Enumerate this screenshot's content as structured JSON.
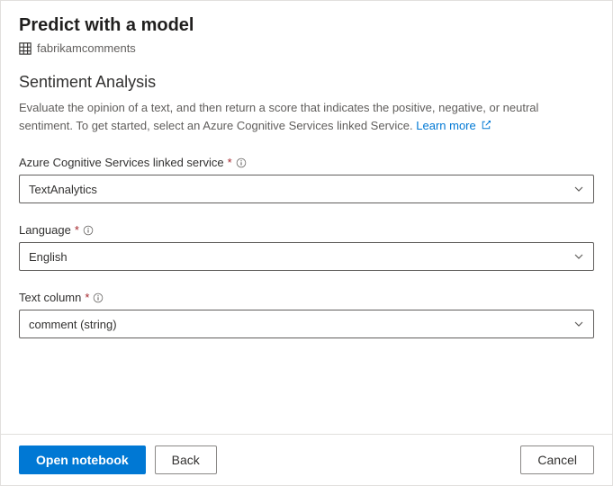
{
  "header": {
    "title": "Predict with a model",
    "subtitle": "fabrikamcomments"
  },
  "section": {
    "title": "Sentiment Analysis",
    "description": "Evaluate the opinion of a text, and then return a score that indicates the positive, negative, or neutral sentiment. To get started, select an Azure Cognitive Services linked Service. ",
    "learn_more": "Learn more"
  },
  "fields": {
    "linked_service": {
      "label": "Azure Cognitive Services linked service",
      "value": "TextAnalytics"
    },
    "language": {
      "label": "Language",
      "value": "English"
    },
    "text_column": {
      "label": "Text column",
      "value": "comment (string)"
    }
  },
  "footer": {
    "open_notebook": "Open notebook",
    "back": "Back",
    "cancel": "Cancel"
  }
}
